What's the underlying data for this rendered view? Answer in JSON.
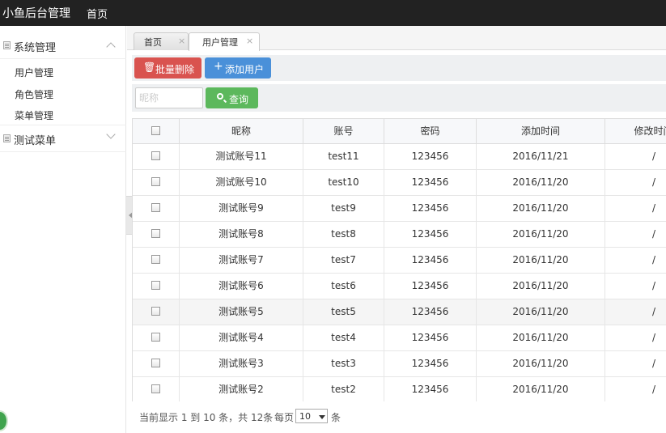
{
  "app": {
    "brand": "小鱼后台管理",
    "top_nav_home": "首页"
  },
  "sidebar": {
    "groups": [
      {
        "label": "系统管理",
        "items": [
          {
            "label": "用户管理"
          },
          {
            "label": "角色管理"
          },
          {
            "label": "菜单管理"
          }
        ]
      },
      {
        "label": "测试菜单"
      }
    ]
  },
  "tabs": [
    {
      "label": "首页",
      "close": "×"
    },
    {
      "label": "用户管理",
      "close": "×"
    }
  ],
  "toolbar": {
    "batch_delete_label": "批量删除",
    "add_user_label": "添加用户",
    "search_label": "查询",
    "nickname_placeholder": "昵称"
  },
  "table": {
    "columns": [
      "",
      "昵称",
      "账号",
      "密码",
      "添加时间",
      "修改时间"
    ],
    "rows": [
      {
        "nickname": "测试账号11",
        "account": "test11",
        "password": "123456",
        "added": "2016/11/21",
        "modified": "/"
      },
      {
        "nickname": "测试账号10",
        "account": "test10",
        "password": "123456",
        "added": "2016/11/20",
        "modified": "/"
      },
      {
        "nickname": "测试账号9",
        "account": "test9",
        "password": "123456",
        "added": "2016/11/20",
        "modified": "/"
      },
      {
        "nickname": "测试账号8",
        "account": "test8",
        "password": "123456",
        "added": "2016/11/20",
        "modified": "/"
      },
      {
        "nickname": "测试账号7",
        "account": "test7",
        "password": "123456",
        "added": "2016/11/20",
        "modified": "/"
      },
      {
        "nickname": "测试账号6",
        "account": "test6",
        "password": "123456",
        "added": "2016/11/20",
        "modified": "/"
      },
      {
        "nickname": "测试账号5",
        "account": "test5",
        "password": "123456",
        "added": "2016/11/20",
        "modified": "/"
      },
      {
        "nickname": "测试账号4",
        "account": "test4",
        "password": "123456",
        "added": "2016/11/20",
        "modified": "/"
      },
      {
        "nickname": "测试账号3",
        "account": "test3",
        "password": "123456",
        "added": "2016/11/20",
        "modified": "/"
      },
      {
        "nickname": "测试账号2",
        "account": "test2",
        "password": "123456",
        "added": "2016/11/20",
        "modified": "/"
      }
    ]
  },
  "pagination": {
    "summary": "当前显示 1 到 10 条，共 12条",
    "per_page_label": "每页",
    "per_page_value": "10",
    "unit": "条"
  },
  "colors": {
    "topbar": "#222222",
    "delete_button": "#d9534f",
    "add_button": "#4a90d9",
    "search_button": "#5cb85c"
  },
  "icons": {
    "delete": "trash-icon",
    "add": "plus-icon",
    "search": "search-icon"
  }
}
